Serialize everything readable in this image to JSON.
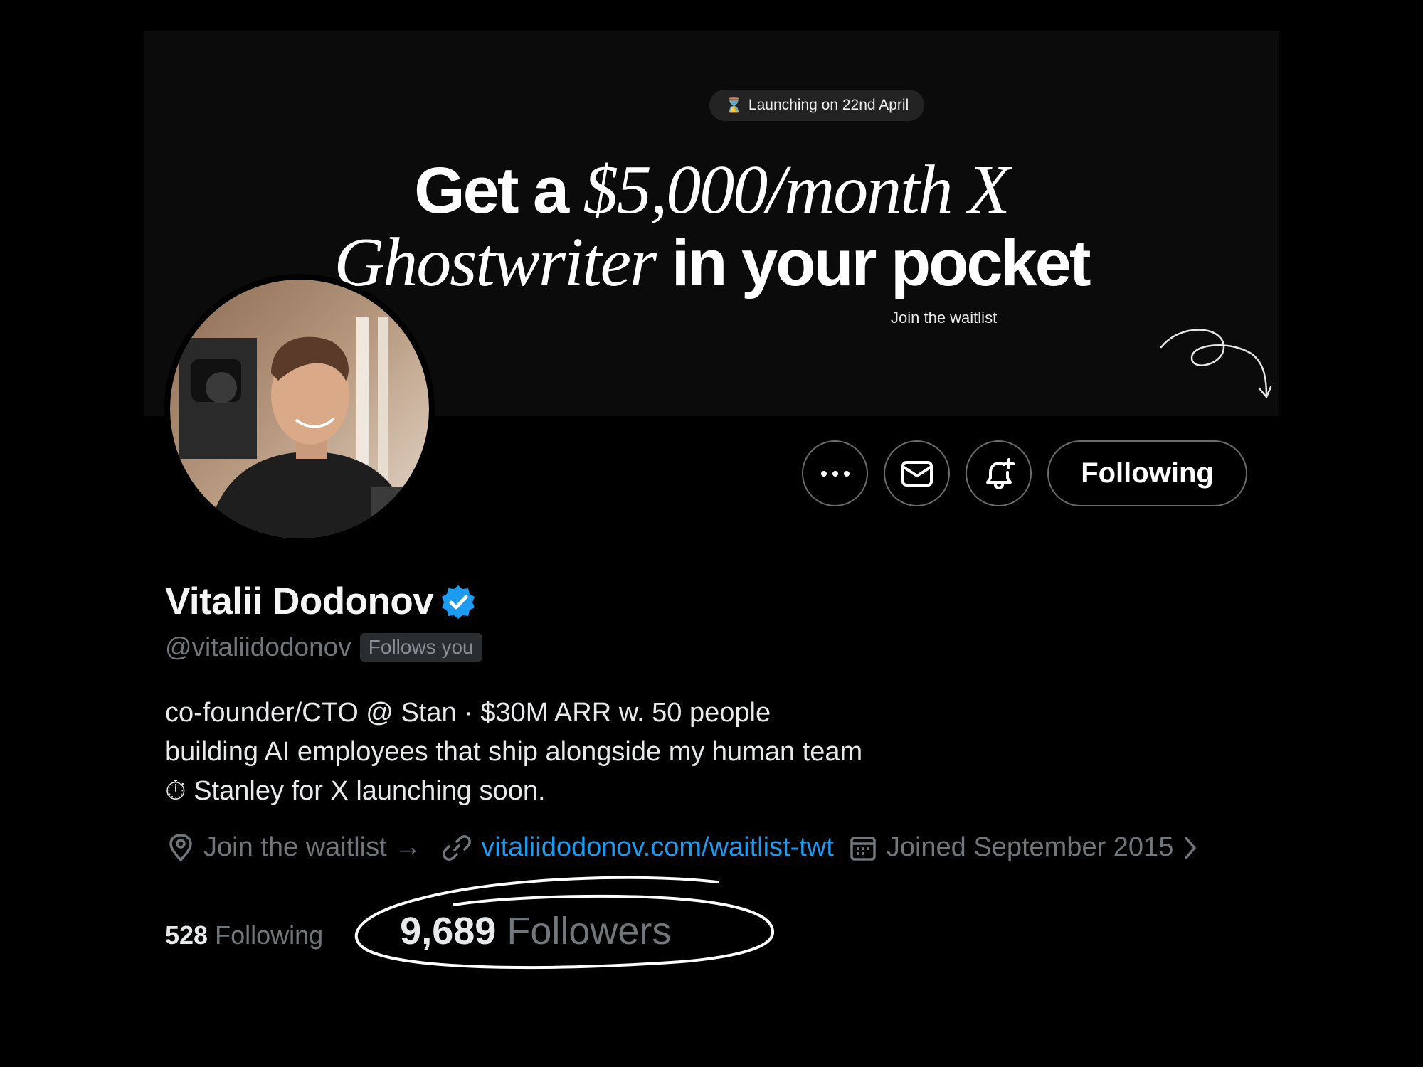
{
  "banner": {
    "pill_icon": "⌛",
    "pill_text": "Launching on 22nd April",
    "line1_bold": "Get a ",
    "line1_italic": "$5,000/month X",
    "line2_italic": "Ghostwriter ",
    "line2_bold": "in your pocket",
    "cta": "Join the waitlist"
  },
  "actions": {
    "more_icon": "more-icon",
    "message_icon": "mail-icon",
    "notify_icon": "bell-plus-icon",
    "following_label": "Following"
  },
  "profile": {
    "name": "Vitalii Dodonov",
    "handle": "@vitaliidodonov",
    "follows_you": "Follows you",
    "bio_line1": "co-founder/CTO @ Stan · $30M ARR w. 50 people",
    "bio_line2": "building AI employees that ship alongside my human team",
    "bio_line3_emoji": "⏱",
    "bio_line3": "Stanley for X launching soon.",
    "location": "Join the waitlist →",
    "website": "vitaliidodonov.com/waitlist-twt",
    "joined": "Joined September 2015"
  },
  "stats": {
    "following_count": "528",
    "following_label": "Following",
    "followers_count": "9,689",
    "followers_label": "Followers"
  },
  "colors": {
    "background": "#000000",
    "link": "#1d9bf0",
    "verified": "#1d9bf0",
    "muted": "#71767b"
  }
}
